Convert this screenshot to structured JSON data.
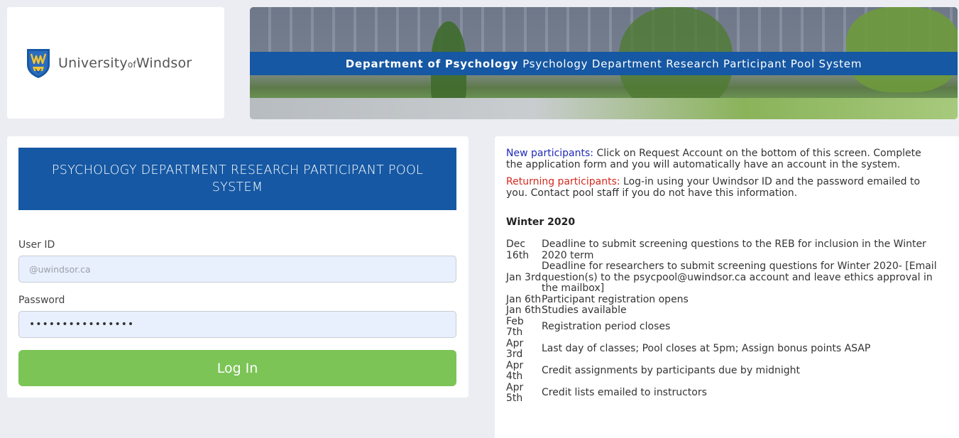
{
  "logo": {
    "part1": "University",
    "part2": "of",
    "part3": "Windsor"
  },
  "banner": {
    "strong": "Department of Psychology",
    "text": "Psychology Department Research Participant Pool System"
  },
  "login": {
    "header": "PSYCHOLOGY DEPARTMENT RESEARCH PARTICIPANT POOL SYSTEM",
    "user_label": "User ID",
    "user_placeholder": "@uwindsor.ca",
    "user_value": "",
    "password_label": "Password",
    "password_value": "••••••••••••••••",
    "button_label": "Log In"
  },
  "info": {
    "new_label": "New participants:",
    "new_text": "Click on Request Account on the bottom of this screen. Complete the application form and you will automatically have an account in the system.",
    "returning_label": "Returning participants:",
    "returning_text": "Log-in using your Uwindsor ID and the password emailed to you. Contact pool staff if you do not have this information.",
    "term_title": "Winter 2020",
    "schedule": [
      {
        "date": "Dec 16th",
        "event": "Deadline to submit screening questions to the REB for inclusion in the Winter 2020 term"
      },
      {
        "date": "Jan 3rd",
        "event": "Deadline for researchers to submit screening questions for Winter 2020- [Email question(s) to the psycpool@uwindsor.ca account and leave ethics approval in the mailbox]"
      },
      {
        "date": "Jan 6th",
        "event": "Participant registration opens"
      },
      {
        "date": "Jan 6th",
        "event": "Studies available"
      },
      {
        "date": "Feb 7th",
        "event": "Registration period closes"
      },
      {
        "date": "Apr 3rd",
        "event": "Last day of classes; Pool closes at 5pm; Assign bonus points ASAP"
      },
      {
        "date": "Apr 4th",
        "event": "Credit assignments by participants due by midnight"
      },
      {
        "date": "Apr 5th",
        "event": "Credit lists emailed to instructors"
      }
    ]
  },
  "colors": {
    "primary_blue": "#1658a3",
    "login_green": "#7cc456",
    "new_label_blue": "#1f2ab8",
    "returning_label_red": "#d42a1e",
    "page_bg": "#ebedf2"
  }
}
